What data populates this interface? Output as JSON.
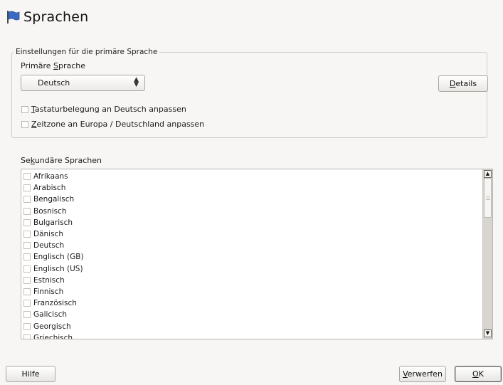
{
  "header": {
    "title": "Sprachen",
    "icon": "flag-icon"
  },
  "primary": {
    "group_label": "Einstellungen für die primäre Sprache",
    "language_label_pre": "Primäre ",
    "language_label_u": "S",
    "language_label_post": "prache",
    "selected": "Deutsch",
    "details_u": "D",
    "details_rest": "etails",
    "keyboard_u": "T",
    "keyboard_rest": "astaturbelegung an Deutsch anpassen",
    "timezone_u": "Z",
    "timezone_rest": "eitzone an Europa / Deutschland anpassen"
  },
  "secondary": {
    "label_pre": "Se",
    "label_u": "k",
    "label_post": "undäre Sprachen",
    "items": [
      "Afrikaans",
      "Arabisch",
      "Bengalisch",
      "Bosnisch",
      "Bulgarisch",
      "Dänisch",
      "Deutsch",
      "Englisch (GB)",
      "Englisch (US)",
      "Estnisch",
      "Finnisch",
      "Französisch",
      "Galicisch",
      "Georgisch",
      "Griechisch"
    ]
  },
  "footer": {
    "help": "Hilfe",
    "discard_u": "V",
    "discard_rest": "erwerfen",
    "ok_u": "O",
    "ok_rest": "K"
  },
  "colors": {
    "background": "#f7f6f5",
    "flag": "#3a6bc4"
  }
}
